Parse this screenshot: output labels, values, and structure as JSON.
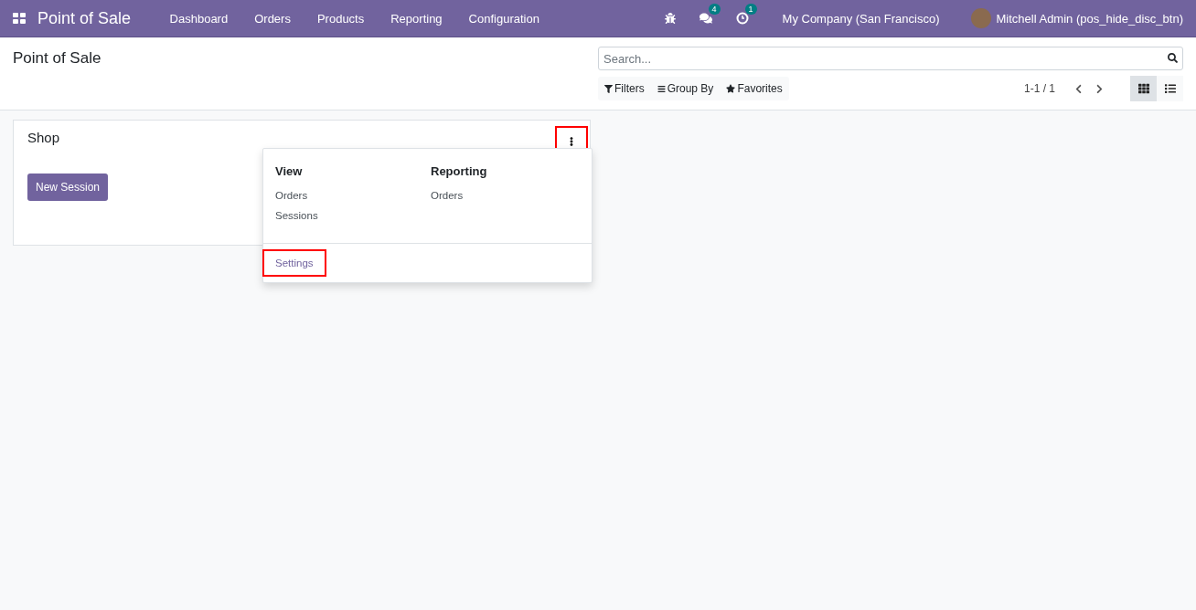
{
  "navbar": {
    "app_title": "Point of Sale",
    "menu": [
      "Dashboard",
      "Orders",
      "Products",
      "Reporting",
      "Configuration"
    ],
    "messages_count": "4",
    "activities_count": "1",
    "company": "My Company (San Francisco)",
    "user": "Mitchell Admin (pos_hide_disc_btn)"
  },
  "control_panel": {
    "title": "Point of Sale",
    "search": {
      "placeholder": "Search..."
    },
    "filters": [
      {
        "kind": "filter",
        "label": "Filters"
      },
      {
        "kind": "group",
        "label": "Group By"
      },
      {
        "kind": "favorite",
        "label": "Favorites"
      }
    ],
    "pager": "1-1 / 1",
    "views": [
      {
        "kind": "kanban",
        "selected": true
      },
      {
        "kind": "list",
        "selected": false
      }
    ]
  },
  "card": {
    "title": "Shop",
    "button": "New Session",
    "menu_button": {
      "highlighted": true
    },
    "dropdown": {
      "sections": [
        {
          "heading": "View",
          "items": [
            "Orders",
            "Sessions"
          ]
        },
        {
          "heading": "Reporting",
          "items": [
            "Orders"
          ]
        }
      ],
      "footer": {
        "label": "Settings",
        "highlighted": true
      }
    }
  }
}
